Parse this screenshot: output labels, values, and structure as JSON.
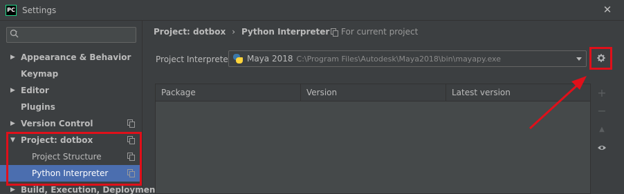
{
  "window": {
    "app_icon_text": "PC",
    "title": "Settings",
    "close_glyph": "✕"
  },
  "sidebar": {
    "search_placeholder": "",
    "search_icon": "search-icon",
    "items": [
      {
        "label": "Appearance & Behavior",
        "arrow": "▶",
        "has_copy_icon": false
      },
      {
        "label": "Keymap",
        "arrow": "",
        "has_copy_icon": false
      },
      {
        "label": "Editor",
        "arrow": "▶",
        "has_copy_icon": false
      },
      {
        "label": "Plugins",
        "arrow": "",
        "has_copy_icon": false
      },
      {
        "label": "Version Control",
        "arrow": "▶",
        "has_copy_icon": true
      },
      {
        "label": "Project: dotbox",
        "arrow": "▼",
        "has_copy_icon": true
      },
      {
        "label": "Project Structure",
        "arrow": "",
        "has_copy_icon": true
      },
      {
        "label": "Python Interpreter",
        "arrow": "",
        "has_copy_icon": true,
        "selected": true
      },
      {
        "label": "Build, Execution, Deployment",
        "arrow": "▶",
        "has_copy_icon": false
      }
    ]
  },
  "main": {
    "breadcrumb": {
      "root": "Project: dotbox",
      "separator": "›",
      "current": "Python Interpreter"
    },
    "scope_label": "For current project",
    "interpreter": {
      "label": "Project Interpreter:",
      "name": "Maya 2018",
      "path": "C:\\Program Files\\Autodesk\\Maya2018\\bin\\mayapy.exe"
    },
    "table": {
      "columns": [
        "Package",
        "Version",
        "Latest version"
      ],
      "rows": []
    },
    "side_tools": {
      "add": "+",
      "remove": "−",
      "upgrade": "▲",
      "show": "eye-icon"
    }
  },
  "colors": {
    "background": "#3c3f41",
    "selection": "#4b6eaf",
    "highlight_red": "#e0101a",
    "table_bg": "#45494a"
  }
}
